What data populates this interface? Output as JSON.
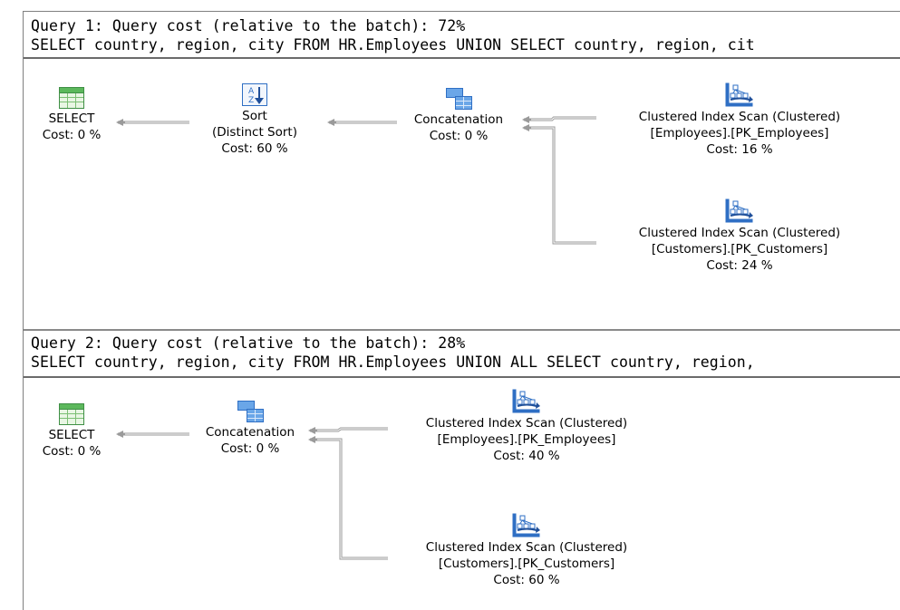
{
  "query1": {
    "cost_line": "Query 1: Query cost (relative to the batch): 72%",
    "sql_line": "SELECT country, region, city FROM HR.Employees UNION SELECT country, region, cit",
    "select": {
      "name": "SELECT",
      "cost": "Cost: 0 %"
    },
    "sort": {
      "name": "Sort",
      "detail": "(Distinct Sort)",
      "cost": "Cost: 60 %"
    },
    "concat": {
      "name": "Concatenation",
      "cost": "Cost: 0 %"
    },
    "scan_employees": {
      "name": "Clustered Index Scan (Clustered)",
      "object": "[Employees].[PK_Employees]",
      "cost": "Cost: 16 %"
    },
    "scan_customers": {
      "name": "Clustered Index Scan (Clustered)",
      "object": "[Customers].[PK_Customers]",
      "cost": "Cost: 24 %"
    }
  },
  "query2": {
    "cost_line": "Query 2: Query cost (relative to the batch): 28%",
    "sql_line": "SELECT country, region, city FROM HR.Employees UNION ALL SELECT country, region,",
    "select": {
      "name": "SELECT",
      "cost": "Cost: 0 %"
    },
    "concat": {
      "name": "Concatenation",
      "cost": "Cost: 0 %"
    },
    "scan_employees": {
      "name": "Clustered Index Scan (Clustered)",
      "object": "[Employees].[PK_Employees]",
      "cost": "Cost: 40 %"
    },
    "scan_customers": {
      "name": "Clustered Index Scan (Clustered)",
      "object": "[Customers].[PK_Customers]",
      "cost": "Cost: 60 %"
    }
  },
  "icons": {
    "select": "select-result-icon",
    "sort": "sort-icon",
    "concat": "concatenation-icon",
    "scan": "clustered-index-scan-icon"
  },
  "colors": {
    "text": "#000000",
    "separator": "#6b6b6b",
    "arrow": "#9a9a9a",
    "select_icon": "#3f9e4a",
    "operator_icon": "#2f6fc4"
  }
}
